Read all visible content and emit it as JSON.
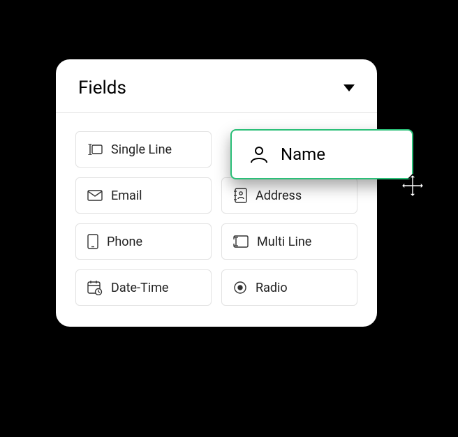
{
  "panel": {
    "title": "Fields"
  },
  "fields": {
    "single_line": {
      "label": "Single Line"
    },
    "name": {
      "label": "Name"
    },
    "email": {
      "label": "Email"
    },
    "address": {
      "label": "Address"
    },
    "phone": {
      "label": "Phone"
    },
    "multi_line": {
      "label": "Multi Line"
    },
    "date_time": {
      "label": "Date-Time"
    },
    "radio": {
      "label": "Radio"
    }
  },
  "colors": {
    "accent": "#2bbf78"
  }
}
